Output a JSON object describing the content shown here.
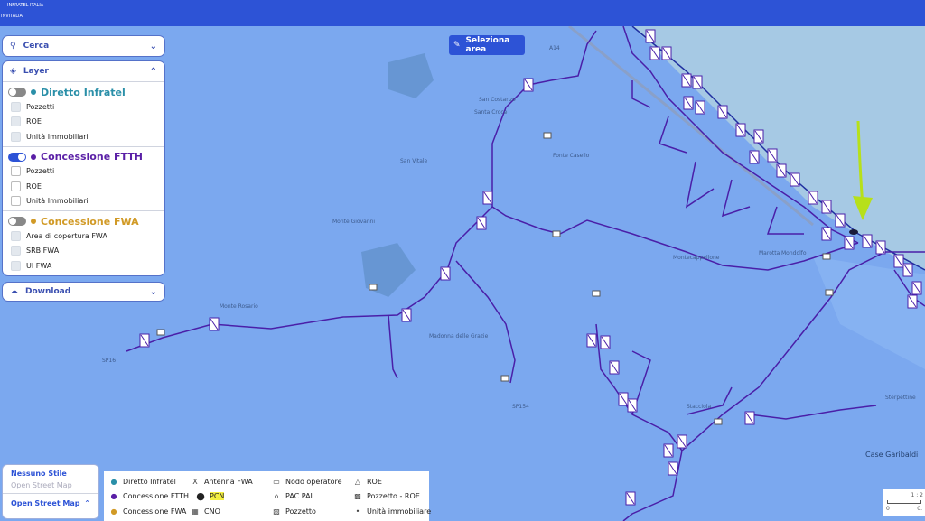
{
  "header": {
    "brand_line1": "INFRATEL ITALIA",
    "brand_line2": "INVITALIA"
  },
  "search": {
    "label": "Cerca"
  },
  "layer": {
    "label": "Layer",
    "sections": [
      {
        "title": "Diretto Infratel",
        "color": "#2a8fa8",
        "enabled": false,
        "items": [
          "Pozzetti",
          "ROE",
          "Unità Immobiliari"
        ]
      },
      {
        "title": "Concessione FTTH",
        "color": "#5a1fa6",
        "enabled": true,
        "items": [
          "Pozzetti",
          "ROE",
          "Unità Immobiliari"
        ]
      },
      {
        "title": "Concessione FWA",
        "color": "#d19a26",
        "enabled": false,
        "items": [
          "Area di copertura FWA",
          "SRB FWA",
          "UI FWA"
        ]
      }
    ]
  },
  "download": {
    "label": "Download"
  },
  "select_area": {
    "label": "Seleziona area"
  },
  "basemap": {
    "options": [
      "Nessuno Stile",
      "Open Street Map"
    ],
    "selected": "Open Street Map"
  },
  "legend": {
    "items": [
      "Diretto Infratel",
      "Antenna FWA",
      "Nodo operatore",
      "ROE",
      "Concessione FTTH",
      "PCN",
      "PAC PAL",
      "Pozzetto - ROE",
      "Concessione FWA",
      "CNO",
      "Pozzetto",
      "Unità immobiliare"
    ]
  },
  "scale": {
    "ratio": "1 : 2",
    "zero": "0",
    "end": "0."
  },
  "map": {
    "places": [
      "San Costanzo",
      "Santa Croce",
      "San Vitale",
      "Fonte Casello",
      "Monte Giovanni",
      "Monte Rosario",
      "Madonna delle Grazie",
      "Montecappellone",
      "Marotta",
      "Mondolfo",
      "Stacciola",
      "Case Garibaldi",
      "Sterpettine",
      "A14",
      "SP16",
      "SP154"
    ]
  },
  "colors": {
    "header": "#2d53d6",
    "map": "#7ba8ef",
    "sea": "#a6c9e4",
    "network": "#4a1fa8",
    "arrow": "#b7e01a",
    "pcn_highlight": "#f4f040"
  }
}
